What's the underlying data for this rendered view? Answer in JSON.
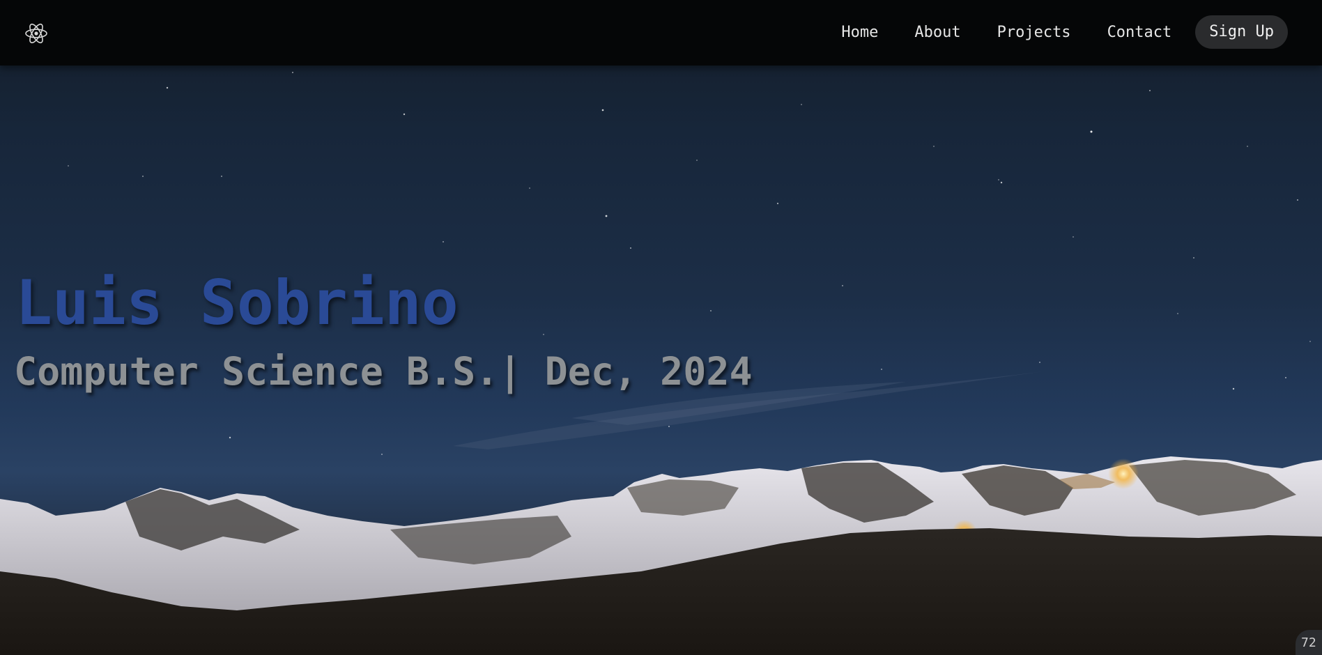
{
  "navbar": {
    "logo_icon": "react-atom-icon",
    "links": [
      {
        "label": "Home"
      },
      {
        "label": "About"
      },
      {
        "label": "Projects"
      },
      {
        "label": "Contact"
      }
    ],
    "signup_label": "Sign Up"
  },
  "hero": {
    "title": "Luis Sobrino",
    "subtitle": "Computer Science B.S.| Dec, 2024",
    "background": "night-sky-snowy-mountains-photo"
  },
  "corner_badge": "72",
  "colors": {
    "navbar_bg": "#050607",
    "title": "#2a4a96",
    "subtitle": "#8d9194",
    "signup_bg": "#2a2b2d"
  }
}
